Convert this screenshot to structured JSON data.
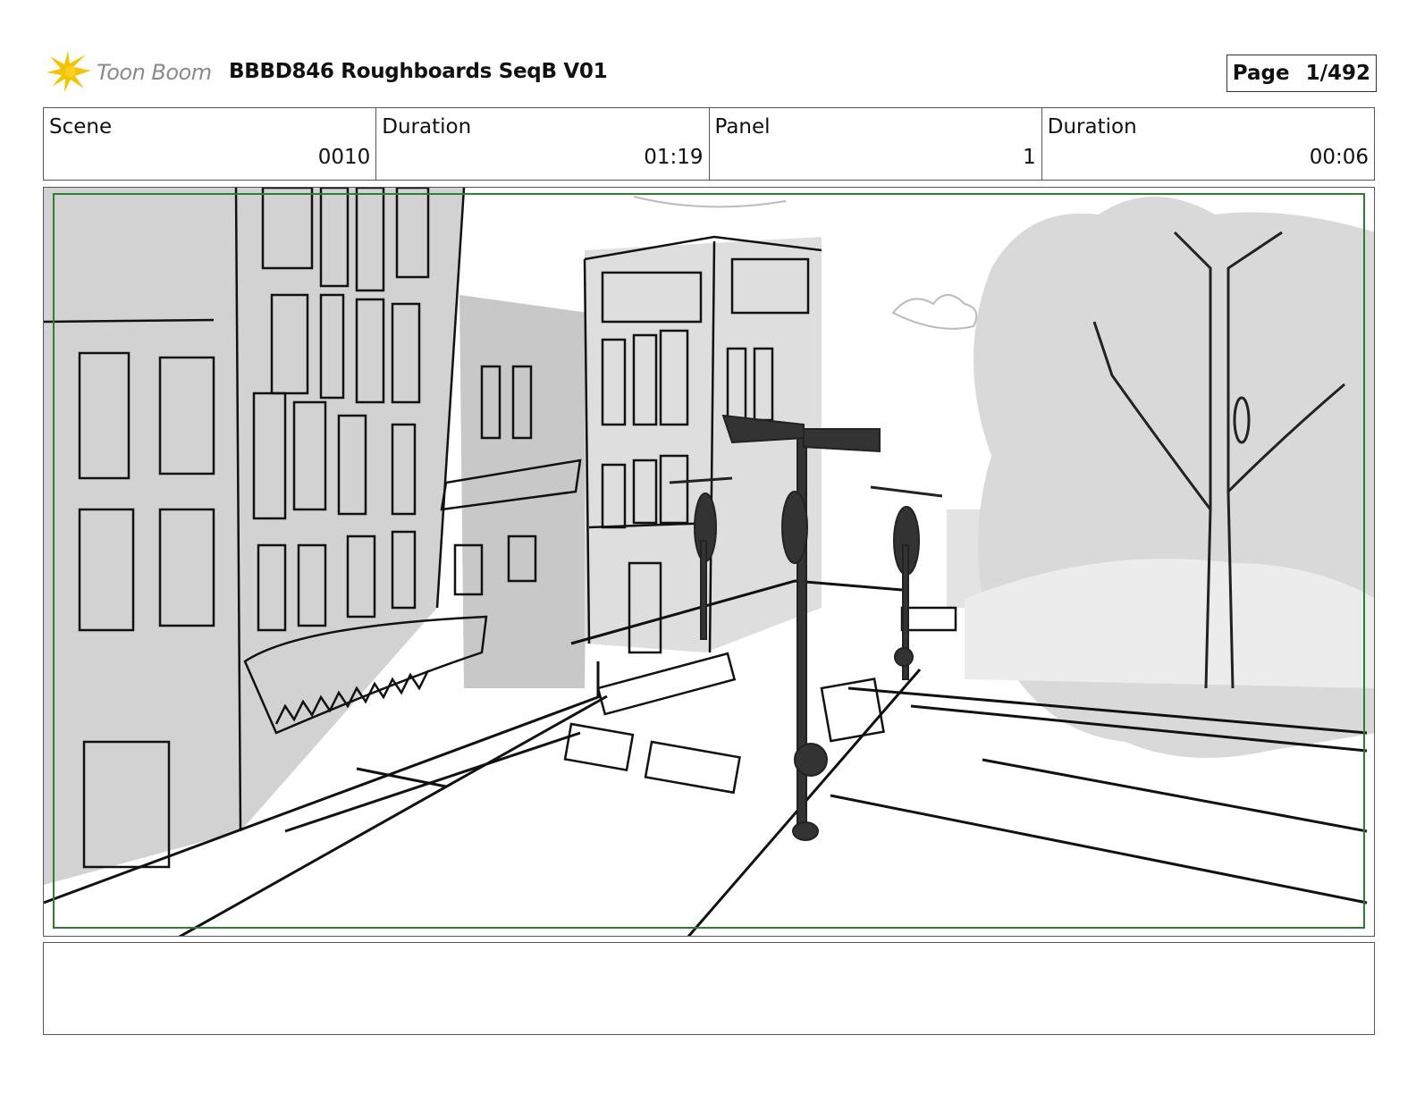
{
  "header": {
    "logo_text": "Toon Boom",
    "title": "BBBD846 Roughboards SeqB V01",
    "page_label": "Page",
    "page_value": "1/492"
  },
  "info": {
    "scene_label": "Scene",
    "scene_value": "0010",
    "scene_duration_label": "Duration",
    "scene_duration_value": "01:19",
    "panel_label": "Panel",
    "panel_value": "1",
    "panel_duration_label": "Duration",
    "panel_duration_value": "00:06"
  },
  "notes": {
    "text": ""
  },
  "colors": {
    "logo_star": "#f5c400",
    "safe_area": "#2e7d32",
    "sketch_gray": "#cfcfcf",
    "ink": "#111111"
  }
}
